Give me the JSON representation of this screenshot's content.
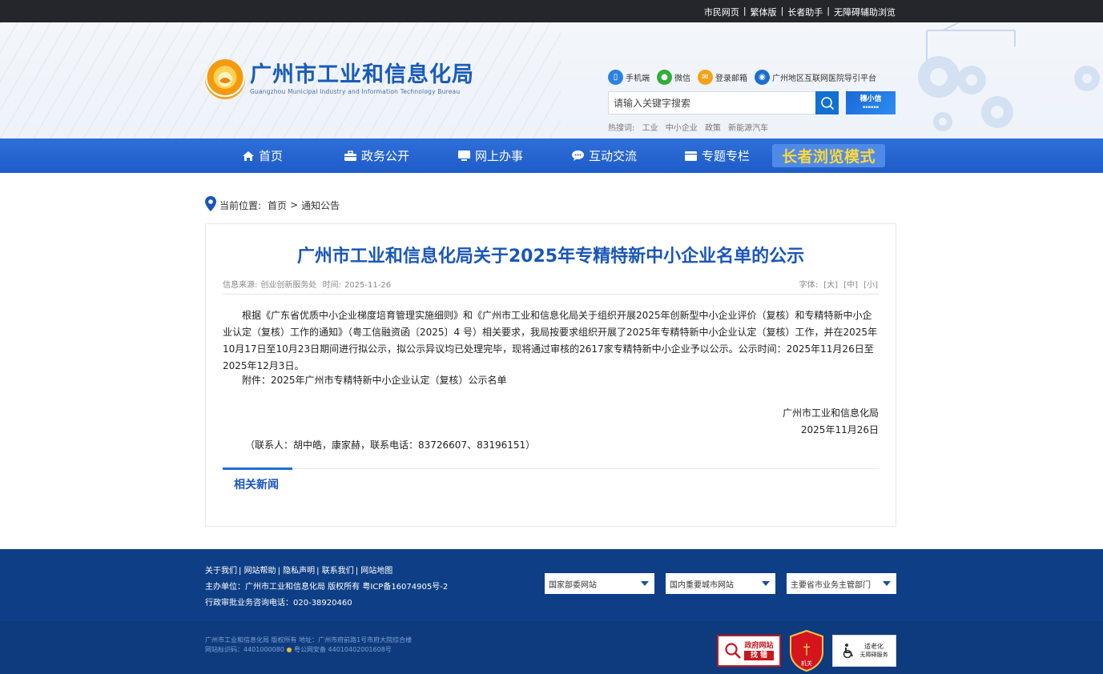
{
  "topbar": {
    "links": [
      "市民网页",
      "繁体版",
      "长者助手",
      "无障碍辅助浏览"
    ]
  },
  "logo": {
    "cn": "广州市工业和信息化局",
    "en": "Guangzhou Municipal Industry and Information Technology Bureau"
  },
  "quicklinks": [
    {
      "label": "手机端",
      "icon": "mobile-icon",
      "color": "#2a82de"
    },
    {
      "label": "微信",
      "icon": "wechat-icon",
      "color": "#2fae3a"
    },
    {
      "label": "登录邮箱",
      "icon": "mail-icon",
      "color": "#f2a318"
    },
    {
      "label": "广州地区互联网医院导引平台",
      "icon": "camera-icon",
      "color": "#1b6dd0"
    }
  ],
  "search": {
    "placeholder": "请输入关键字搜索",
    "assistant": "穗小信",
    "hot_label": "热搜词:",
    "hot_words": [
      "工业",
      "中小企业",
      "政策",
      "新能源汽车"
    ]
  },
  "nav": {
    "items": [
      "首页",
      "政务公开",
      "网上办事",
      "互动交流",
      "专题专栏"
    ],
    "elder_mode": "长者浏览模式"
  },
  "breadcrumb": {
    "label": "当前位置:",
    "home": "首页",
    "sep": ">",
    "current": "通知公告"
  },
  "article": {
    "title": "广州市工业和信息化局关于2025年专精特新中小企业名单的公示",
    "source_label": "信息来源:",
    "source": "创业创新服务处",
    "time_label": "时间:",
    "time": "2025-11-26",
    "font_label": "字体:",
    "font_sizes": [
      "[大]",
      "[中]",
      "[小]"
    ],
    "body": "根据《广东省优质中小企业梯度培育管理实施细则》和《广州市工业和信息化局关于组织开展2025年创新型中小企业评价（复核）和专精特新中小企业认定（复核）工作的通知》（粤工信融资函〔2025〕4 号）相关要求，我局按要求组织开展了2025年专精特新中小企业认定（复核）工作，并在2025年10月17日至10月23日期间进行拟公示，拟公示异议均已处理完毕，现将通过审核的2617家专精特新中小企业予以公示。公示时间：2025年11月26日至2025年12月3日。",
    "attachment": "附件：2025年广州市专精特新中小企业认定（复核）公示名单",
    "sign_org": "广州市工业和信息化局",
    "sign_date": "2025年11月26日",
    "contact": "（联系人：胡中皓，康家赫，联系电话：83726607、83196151）",
    "related": "相关新闻"
  },
  "footer": {
    "links": [
      "关于我们",
      "网站帮助",
      "隐私声明",
      "联系我们",
      "网站地图"
    ],
    "sponsor": "主办单位：广州市工业和信息化局 版权所有 粤ICP备16074905号-2",
    "hotline": "行政审批业务咨询电话：020-38920460",
    "selects": [
      "国家部委网站",
      "国内重要城市网站",
      "主要省市业务主管部门"
    ],
    "bottom1": "广州市工业和信息化局 版权所有 地址：广州市府前路1号市府大院综合楼",
    "bottom2": "网站标识码：4401000080",
    "bottom3": "粤公网安备 44010402001608号",
    "badge_zhaocuo_1": "政府网站",
    "badge_zhaocuo_2": "找 错",
    "badge_jiguan": "机关",
    "badge_elder_1": "适老化",
    "badge_elder_2": "无障碍服务"
  }
}
